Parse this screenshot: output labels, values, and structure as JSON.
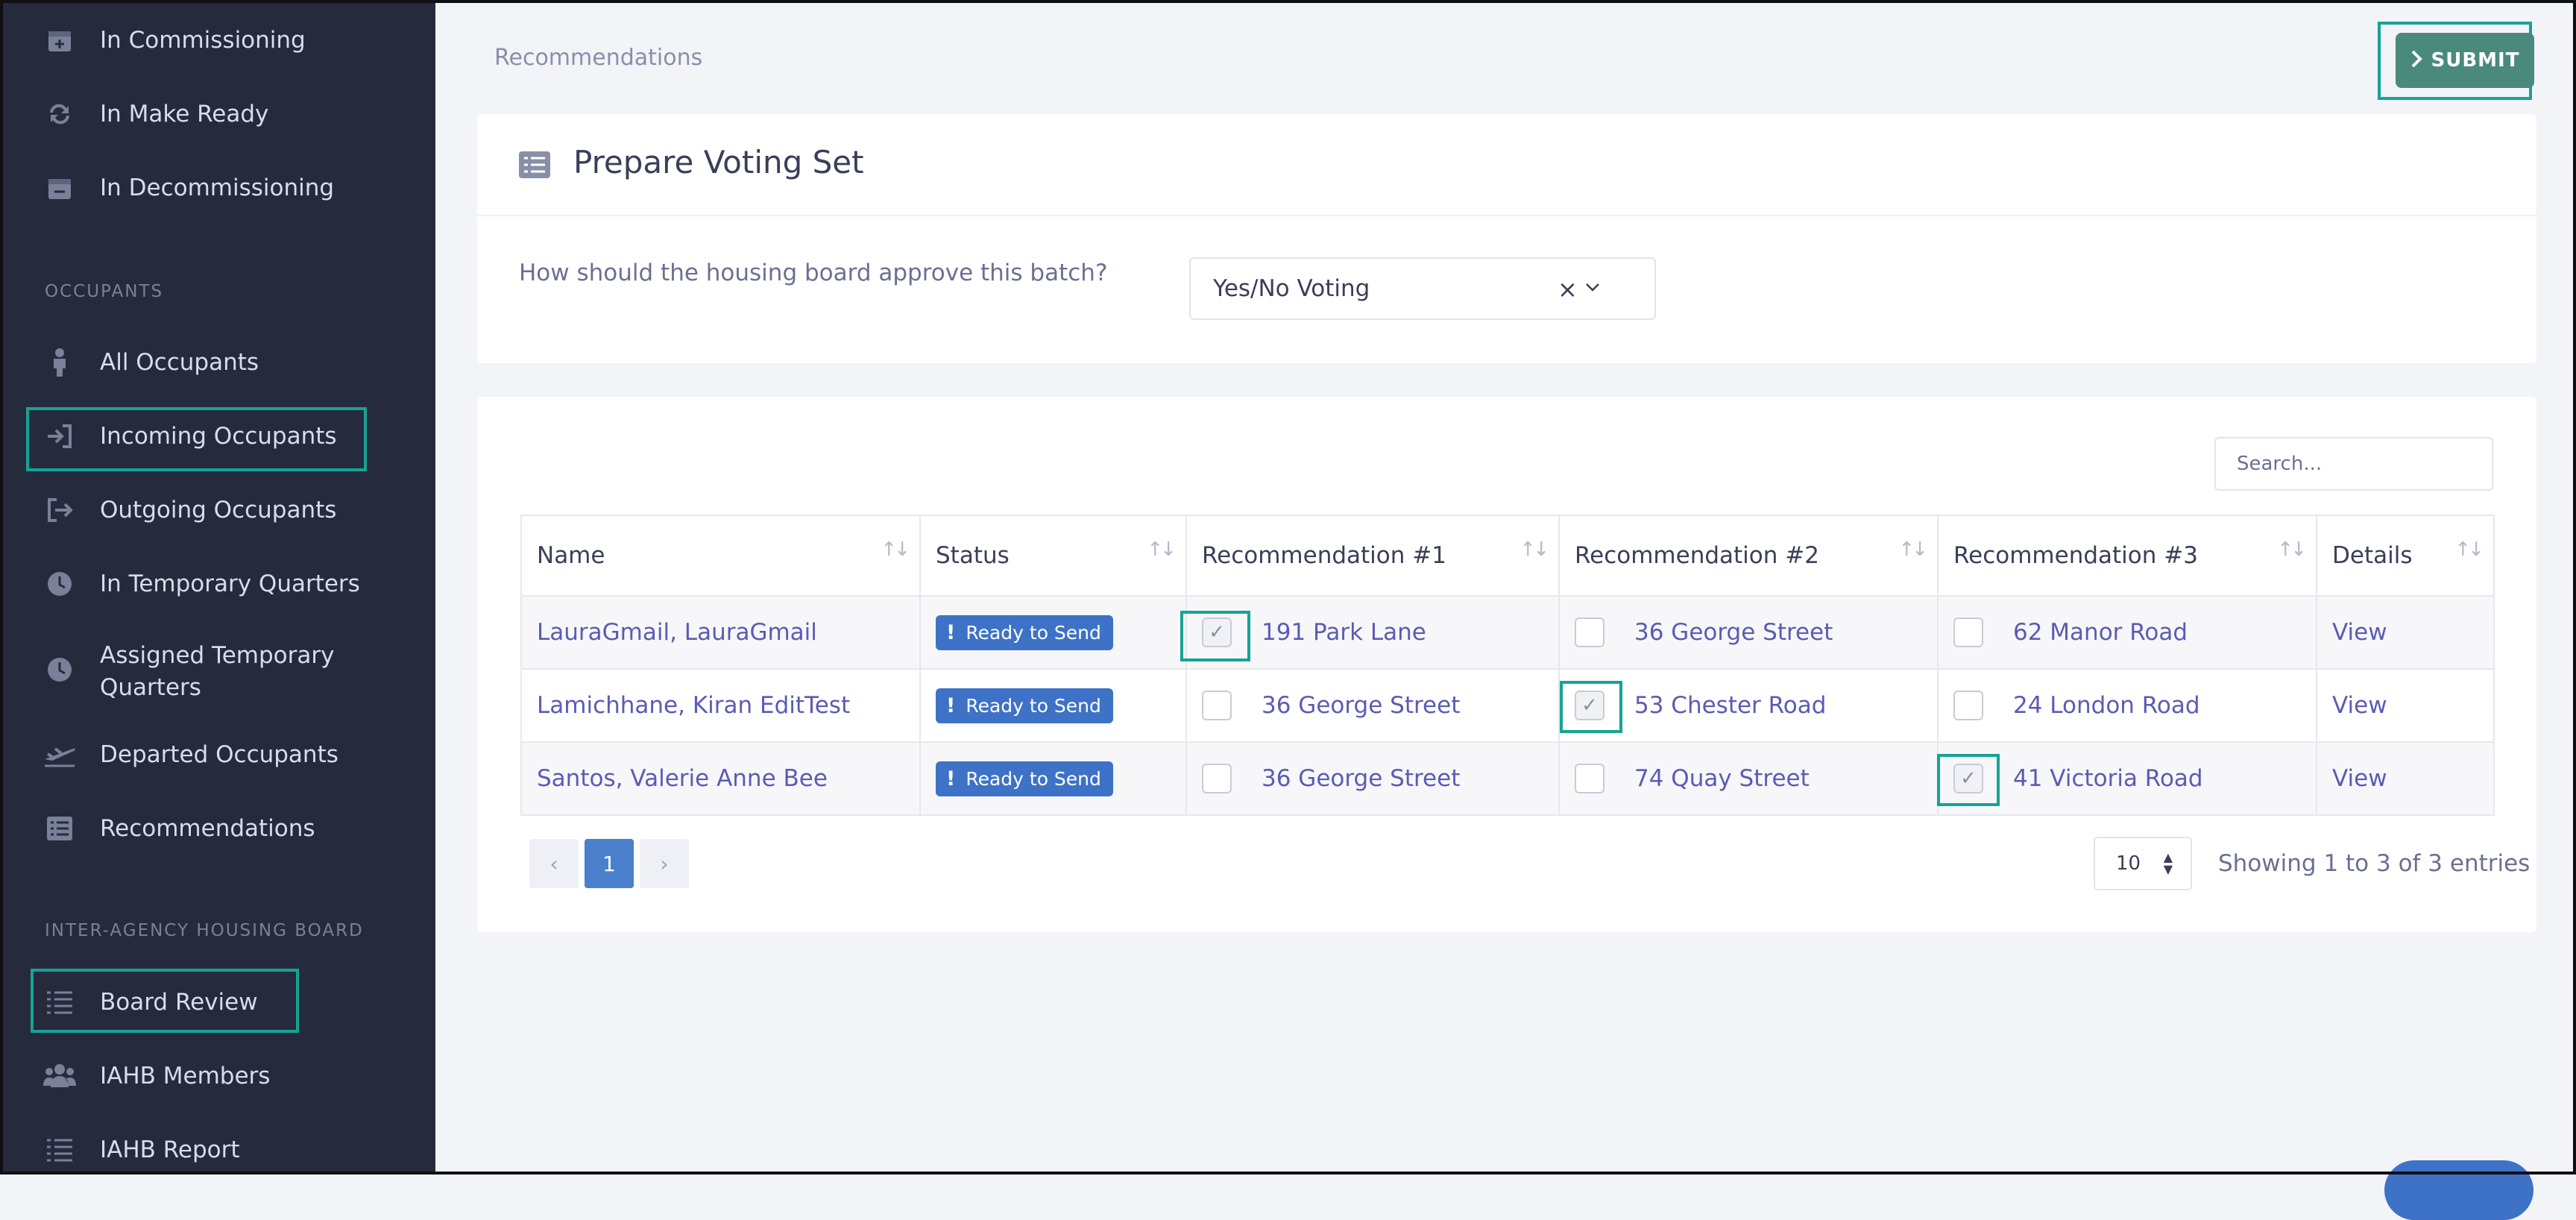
{
  "sidebar": {
    "items_top": [
      {
        "label": "In Commissioning",
        "icon": "calendar-plus-icon"
      },
      {
        "label": "In Make Ready",
        "icon": "refresh-icon"
      },
      {
        "label": "In Decommissioning",
        "icon": "calendar-minus-icon"
      }
    ],
    "section_occupants": "OCCUPANTS",
    "occupants_items": [
      {
        "label": "All Occupants",
        "icon": "person-icon"
      },
      {
        "label": "Incoming Occupants",
        "icon": "sign-in-icon"
      },
      {
        "label": "Outgoing Occupants",
        "icon": "sign-out-icon"
      },
      {
        "label": "In Temporary Quarters",
        "icon": "clock-icon"
      },
      {
        "label_line1": "Assigned Temporary",
        "label_line2": "Quarters",
        "icon": "clock-icon"
      },
      {
        "label": "Departed Occupants",
        "icon": "plane-icon"
      },
      {
        "label": "Recommendations",
        "icon": "list-box-icon"
      }
    ],
    "section_board": "INTER-AGENCY HOUSING BOARD",
    "board_items": [
      {
        "label": "Board Review",
        "icon": "list-icon"
      },
      {
        "label": "IAHB Members",
        "icon": "users-icon"
      },
      {
        "label": "IAHB Report",
        "icon": "list-icon"
      }
    ]
  },
  "header": {
    "breadcrumb": "Recommendations",
    "submit_label": "SUBMIT"
  },
  "voting_card": {
    "title": "Prepare Voting Set",
    "question": "How should the housing board approve this batch?",
    "selected_option": "Yes/No Voting",
    "clear_glyph": "×",
    "dropdown_glyph": "⌄"
  },
  "table": {
    "search_placeholder": "Search...",
    "columns": [
      "Name",
      "Status",
      "Recommendation #1",
      "Recommendation #2",
      "Recommendation #3",
      "Details"
    ],
    "rows": [
      {
        "name": "LauraGmail, LauraGmail",
        "status": "Ready to Send",
        "rec1": "191 Park Lane",
        "rec2": "36 George Street",
        "rec3": "62 Manor Road",
        "details": "View",
        "checked": [
          true,
          false,
          false
        ]
      },
      {
        "name": "Lamichhane, Kiran EditTest",
        "status": "Ready to Send",
        "rec1": "36 George Street",
        "rec2": "53 Chester Road",
        "rec3": "24 London Road",
        "details": "View",
        "checked": [
          false,
          true,
          false
        ]
      },
      {
        "name": "Santos, Valerie Anne Bee",
        "status": "Ready to Send",
        "rec1": "36 George Street",
        "rec2": "74 Quay Street",
        "rec3": "41 Victoria Road",
        "details": "View",
        "checked": [
          false,
          false,
          true
        ]
      }
    ],
    "pagination": {
      "prev": "‹",
      "current": "1",
      "next": "›"
    },
    "page_size": "10",
    "showing": "Showing 1 to 3 of 3 entries"
  },
  "colors": {
    "sidebar_bg": "#262a3d",
    "highlight": "#16a394",
    "submit_bg": "#4a8a7c",
    "badge": "#3e72c7",
    "link": "#5b5bb5"
  }
}
